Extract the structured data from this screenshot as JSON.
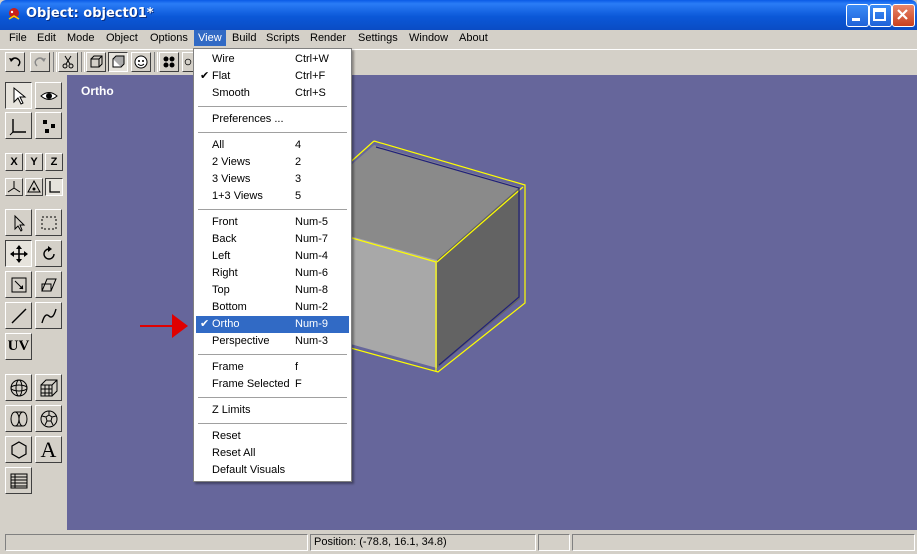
{
  "window": {
    "title": "Object: object01*",
    "accent": "#0a4cc4"
  },
  "menubar": {
    "items": [
      "File",
      "Edit",
      "Mode",
      "Object",
      "Options",
      "View",
      "Build",
      "Scripts",
      "Render",
      "Settings",
      "Window",
      "About"
    ],
    "active": "View"
  },
  "viewport": {
    "label": "Ortho",
    "background": "#66669b"
  },
  "view_menu": {
    "groups": [
      [
        {
          "label": "Wire",
          "shortcut": "Ctrl+W",
          "checked": false
        },
        {
          "label": "Flat",
          "shortcut": "Ctrl+F",
          "checked": true
        },
        {
          "label": "Smooth",
          "shortcut": "Ctrl+S",
          "checked": false
        }
      ],
      [
        {
          "label": "Preferences ...",
          "shortcut": "",
          "checked": false
        }
      ],
      [
        {
          "label": "All",
          "shortcut": "4",
          "checked": false
        },
        {
          "label": "2 Views",
          "shortcut": "2",
          "checked": false
        },
        {
          "label": "3 Views",
          "shortcut": "3",
          "checked": false
        },
        {
          "label": "1+3 Views",
          "shortcut": "5",
          "checked": false
        }
      ],
      [
        {
          "label": "Front",
          "shortcut": "Num-5",
          "checked": false
        },
        {
          "label": "Back",
          "shortcut": "Num-7",
          "checked": false
        },
        {
          "label": "Left",
          "shortcut": "Num-4",
          "checked": false
        },
        {
          "label": "Right",
          "shortcut": "Num-6",
          "checked": false
        },
        {
          "label": "Top",
          "shortcut": "Num-8",
          "checked": false
        },
        {
          "label": "Bottom",
          "shortcut": "Num-2",
          "checked": false
        },
        {
          "label": "Ortho",
          "shortcut": "Num-9",
          "checked": true,
          "highlighted": true
        },
        {
          "label": "Perspective",
          "shortcut": "Num-3",
          "checked": false
        }
      ],
      [
        {
          "label": "Frame",
          "shortcut": "f",
          "checked": false
        },
        {
          "label": "Frame Selected",
          "shortcut": "F",
          "checked": false
        }
      ],
      [
        {
          "label": "Z Limits",
          "shortcut": "",
          "checked": false
        }
      ],
      [
        {
          "label": "Reset",
          "shortcut": "",
          "checked": false
        },
        {
          "label": "Reset All",
          "shortcut": "",
          "checked": false
        },
        {
          "label": "Default Visuals",
          "shortcut": "",
          "checked": false
        }
      ]
    ],
    "highlight_color": "#316ac5"
  },
  "toolpanel": {
    "axis_buttons": [
      "X",
      "Y",
      "Z"
    ],
    "uv_label": "UV",
    "text_tool_label": "A"
  },
  "statusbar": {
    "position": "Position: (-78.8, 16.1, 34.8)"
  },
  "annotation": {
    "arrow_color": "#e00000"
  }
}
